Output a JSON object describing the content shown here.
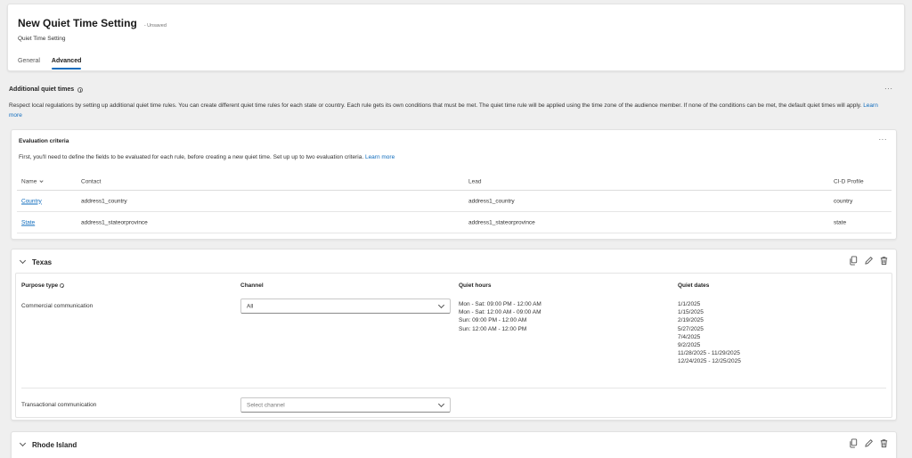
{
  "header": {
    "title": "New Quiet Time Setting",
    "status": "- Unsaved",
    "subtitle": "Quiet Time Setting",
    "tabs": [
      {
        "label": "General"
      },
      {
        "label": "Advanced"
      }
    ]
  },
  "section": {
    "title": "Additional quiet times",
    "more": "···",
    "description": "Respect local regulations by setting up additional quiet time rules. You can create different quiet time rules for each state or country. Each rule gets its own conditions that must be met. The quiet time rule will be applied using the time zone of the audience member. If none of the conditions can be met, the default quiet times will apply.",
    "learn_more": "Learn more"
  },
  "evaluation": {
    "title": "Evaluation criteria",
    "more": "···",
    "description": "First, you'll need to define the fields to be evaluated for each rule, before creating a new quiet time. Set up up to two evaluation criteria.",
    "learn_more": "Learn more",
    "columns": [
      "Name",
      "Contact",
      "Lead",
      "CI-D Profile"
    ],
    "rows": [
      {
        "name": "Country",
        "contact": "address1_country",
        "lead": "address1_country",
        "profile": "country"
      },
      {
        "name": "State",
        "contact": "address1_stateorprovince",
        "lead": "address1_stateorprovince",
        "profile": "state"
      }
    ]
  },
  "rules": [
    {
      "name": "Texas",
      "columns": {
        "purpose": "Purpose type",
        "channel": "Channel",
        "hours": "Quiet hours",
        "dates": "Quiet dates"
      },
      "commercial": {
        "label": "Commercial communication",
        "channel": "All",
        "hours": [
          "Mon - Sat: 09:00 PM - 12:00 AM",
          "Mon - Sat: 12:00 AM - 09:00 AM",
          "Sun: 09:00 PM - 12:00 AM",
          "Sun: 12:00 AM - 12:00 PM"
        ],
        "dates": [
          "1/1/2025",
          "1/15/2025",
          "2/19/2025",
          "5/27/2025",
          "7/4/2025",
          "9/2/2025",
          "11/28/2025 - 11/29/2025",
          "12/24/2025 - 12/25/2025"
        ]
      },
      "transactional": {
        "label": "Transactional communication",
        "channel_placeholder": "Select channel"
      }
    },
    {
      "name": "Rhode Island"
    }
  ]
}
